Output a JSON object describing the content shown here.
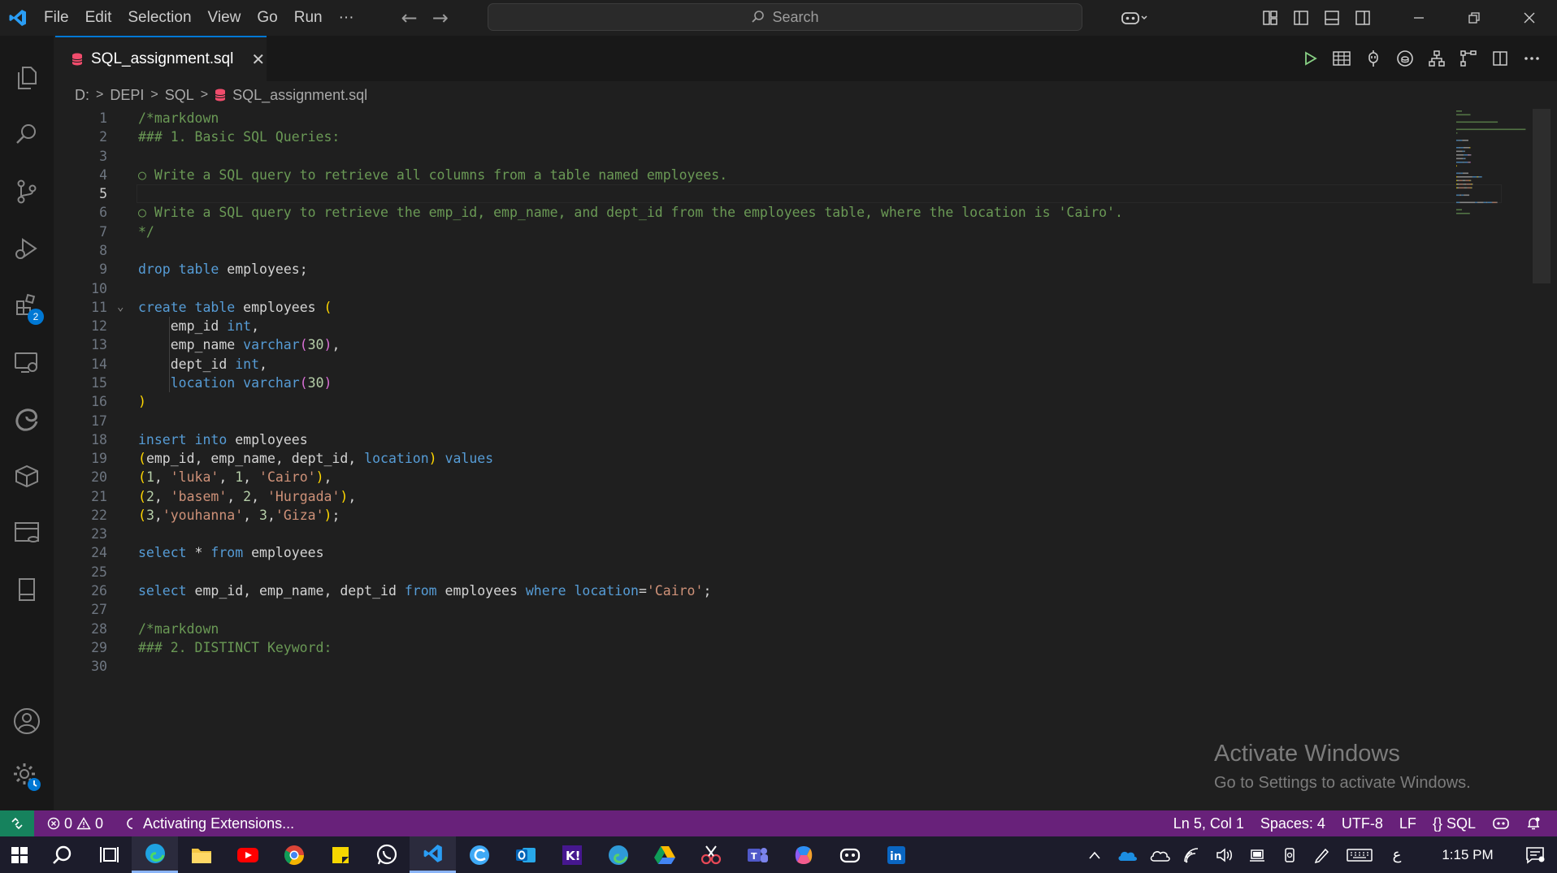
{
  "menu": [
    "File",
    "Edit",
    "Selection",
    "View",
    "Go",
    "Run",
    "···"
  ],
  "search": {
    "label": "Search"
  },
  "tab": {
    "filename": "SQL_assignment.sql",
    "close": "✕"
  },
  "breadcrumb": [
    "D:",
    "DEPI",
    "SQL",
    "SQL_assignment.sql"
  ],
  "activity": {
    "extensions_badge": "2"
  },
  "editor": {
    "active_line": 5,
    "lines": [
      {
        "n": "1",
        "tokens": [
          [
            "cmt",
            "/*markdown"
          ]
        ]
      },
      {
        "n": "2",
        "tokens": [
          [
            "cmt",
            "### 1. Basic SQL Queries:"
          ]
        ]
      },
      {
        "n": "3",
        "tokens": []
      },
      {
        "n": "4",
        "tokens": [
          [
            "cmt",
            "○ Write a SQL query to retrieve all columns from a table named employees."
          ]
        ]
      },
      {
        "n": "5",
        "tokens": []
      },
      {
        "n": "6",
        "tokens": [
          [
            "cmt",
            "○ Write a SQL query to retrieve the emp_id, emp_name, and dept_id from the employees table, where the location is 'Cairo'."
          ]
        ]
      },
      {
        "n": "7",
        "tokens": [
          [
            "cmt",
            "*/"
          ]
        ]
      },
      {
        "n": "8",
        "tokens": []
      },
      {
        "n": "9",
        "tokens": [
          [
            "kw",
            "drop"
          ],
          [
            "id",
            " "
          ],
          [
            "kw",
            "table"
          ],
          [
            "id",
            " employees;"
          ]
        ]
      },
      {
        "n": "10",
        "tokens": []
      },
      {
        "n": "11",
        "tokens": [
          [
            "kw",
            "create"
          ],
          [
            "id",
            " "
          ],
          [
            "kw",
            "table"
          ],
          [
            "id",
            " employees "
          ],
          [
            "br",
            "("
          ]
        ]
      },
      {
        "n": "12",
        "tokens": [
          [
            "id",
            "    emp_id "
          ],
          [
            "kw",
            "int"
          ],
          [
            "id",
            ","
          ]
        ]
      },
      {
        "n": "13",
        "tokens": [
          [
            "id",
            "    emp_name "
          ],
          [
            "kw",
            "varchar"
          ],
          [
            "br2",
            "("
          ],
          [
            "num",
            "30"
          ],
          [
            "br2",
            ")"
          ],
          [
            "id",
            ","
          ]
        ]
      },
      {
        "n": "14",
        "tokens": [
          [
            "id",
            "    dept_id "
          ],
          [
            "kw",
            "int"
          ],
          [
            "id",
            ","
          ]
        ]
      },
      {
        "n": "15",
        "tokens": [
          [
            "kw",
            "    location"
          ],
          [
            "id",
            " "
          ],
          [
            "kw",
            "varchar"
          ],
          [
            "br2",
            "("
          ],
          [
            "num",
            "30"
          ],
          [
            "br2",
            ")"
          ]
        ]
      },
      {
        "n": "16",
        "tokens": [
          [
            "br",
            ")"
          ]
        ]
      },
      {
        "n": "17",
        "tokens": []
      },
      {
        "n": "18",
        "tokens": [
          [
            "kw",
            "insert"
          ],
          [
            "id",
            " "
          ],
          [
            "kw",
            "into"
          ],
          [
            "id",
            " employees"
          ]
        ]
      },
      {
        "n": "19",
        "tokens": [
          [
            "br",
            "("
          ],
          [
            "id",
            "emp_id, emp_name, dept_id, "
          ],
          [
            "kw",
            "location"
          ],
          [
            "br",
            ")"
          ],
          [
            "id",
            " "
          ],
          [
            "kw",
            "values"
          ]
        ]
      },
      {
        "n": "20",
        "tokens": [
          [
            "br",
            "("
          ],
          [
            "num",
            "1"
          ],
          [
            "id",
            ", "
          ],
          [
            "str",
            "'luka'"
          ],
          [
            "id",
            ", "
          ],
          [
            "num",
            "1"
          ],
          [
            "id",
            ", "
          ],
          [
            "str",
            "'Cairo'"
          ],
          [
            "br",
            ")"
          ],
          [
            "id",
            ","
          ]
        ]
      },
      {
        "n": "21",
        "tokens": [
          [
            "br",
            "("
          ],
          [
            "num",
            "2"
          ],
          [
            "id",
            ", "
          ],
          [
            "str",
            "'basem'"
          ],
          [
            "id",
            ", "
          ],
          [
            "num",
            "2"
          ],
          [
            "id",
            ", "
          ],
          [
            "str",
            "'Hurgada'"
          ],
          [
            "br",
            ")"
          ],
          [
            "id",
            ","
          ]
        ]
      },
      {
        "n": "22",
        "tokens": [
          [
            "br",
            "("
          ],
          [
            "num",
            "3"
          ],
          [
            "id",
            ","
          ],
          [
            "str",
            "'youhanna'"
          ],
          [
            "id",
            ", "
          ],
          [
            "num",
            "3"
          ],
          [
            "id",
            ","
          ],
          [
            "str",
            "'Giza'"
          ],
          [
            "br",
            ")"
          ],
          [
            "id",
            ";"
          ]
        ]
      },
      {
        "n": "23",
        "tokens": []
      },
      {
        "n": "24",
        "tokens": [
          [
            "kw",
            "select"
          ],
          [
            "id",
            " * "
          ],
          [
            "kw",
            "from"
          ],
          [
            "id",
            " employees"
          ]
        ]
      },
      {
        "n": "25",
        "tokens": []
      },
      {
        "n": "26",
        "tokens": [
          [
            "kw",
            "select"
          ],
          [
            "id",
            " emp_id, emp_name, dept_id "
          ],
          [
            "kw",
            "from"
          ],
          [
            "id",
            " employees "
          ],
          [
            "kw",
            "where"
          ],
          [
            "id",
            " "
          ],
          [
            "kw",
            "location"
          ],
          [
            "id",
            "="
          ],
          [
            "str",
            "'Cairo'"
          ],
          [
            "id",
            ";"
          ]
        ]
      },
      {
        "n": "27",
        "tokens": []
      },
      {
        "n": "28",
        "tokens": [
          [
            "cmt",
            "/*markdown"
          ]
        ]
      },
      {
        "n": "29",
        "tokens": [
          [
            "cmt",
            "### 2. DISTINCT Keyword:"
          ]
        ]
      },
      {
        "n": "30",
        "tokens": []
      }
    ]
  },
  "watermark": {
    "line1": "Activate Windows",
    "line2": "Go to Settings to activate Windows."
  },
  "status": {
    "errors": "0",
    "warnings": "0",
    "activity": "Activating Extensions...",
    "cursor": "Ln 5, Col 1",
    "spaces": "Spaces: 4",
    "encoding": "UTF-8",
    "eol": "LF",
    "language": "SQL"
  },
  "taskbar": {
    "time": "1:15 PM",
    "lang": "ع"
  },
  "colors": {
    "statusbar": "#68217a",
    "accent": "#0078d4",
    "remote": "#16825d"
  }
}
